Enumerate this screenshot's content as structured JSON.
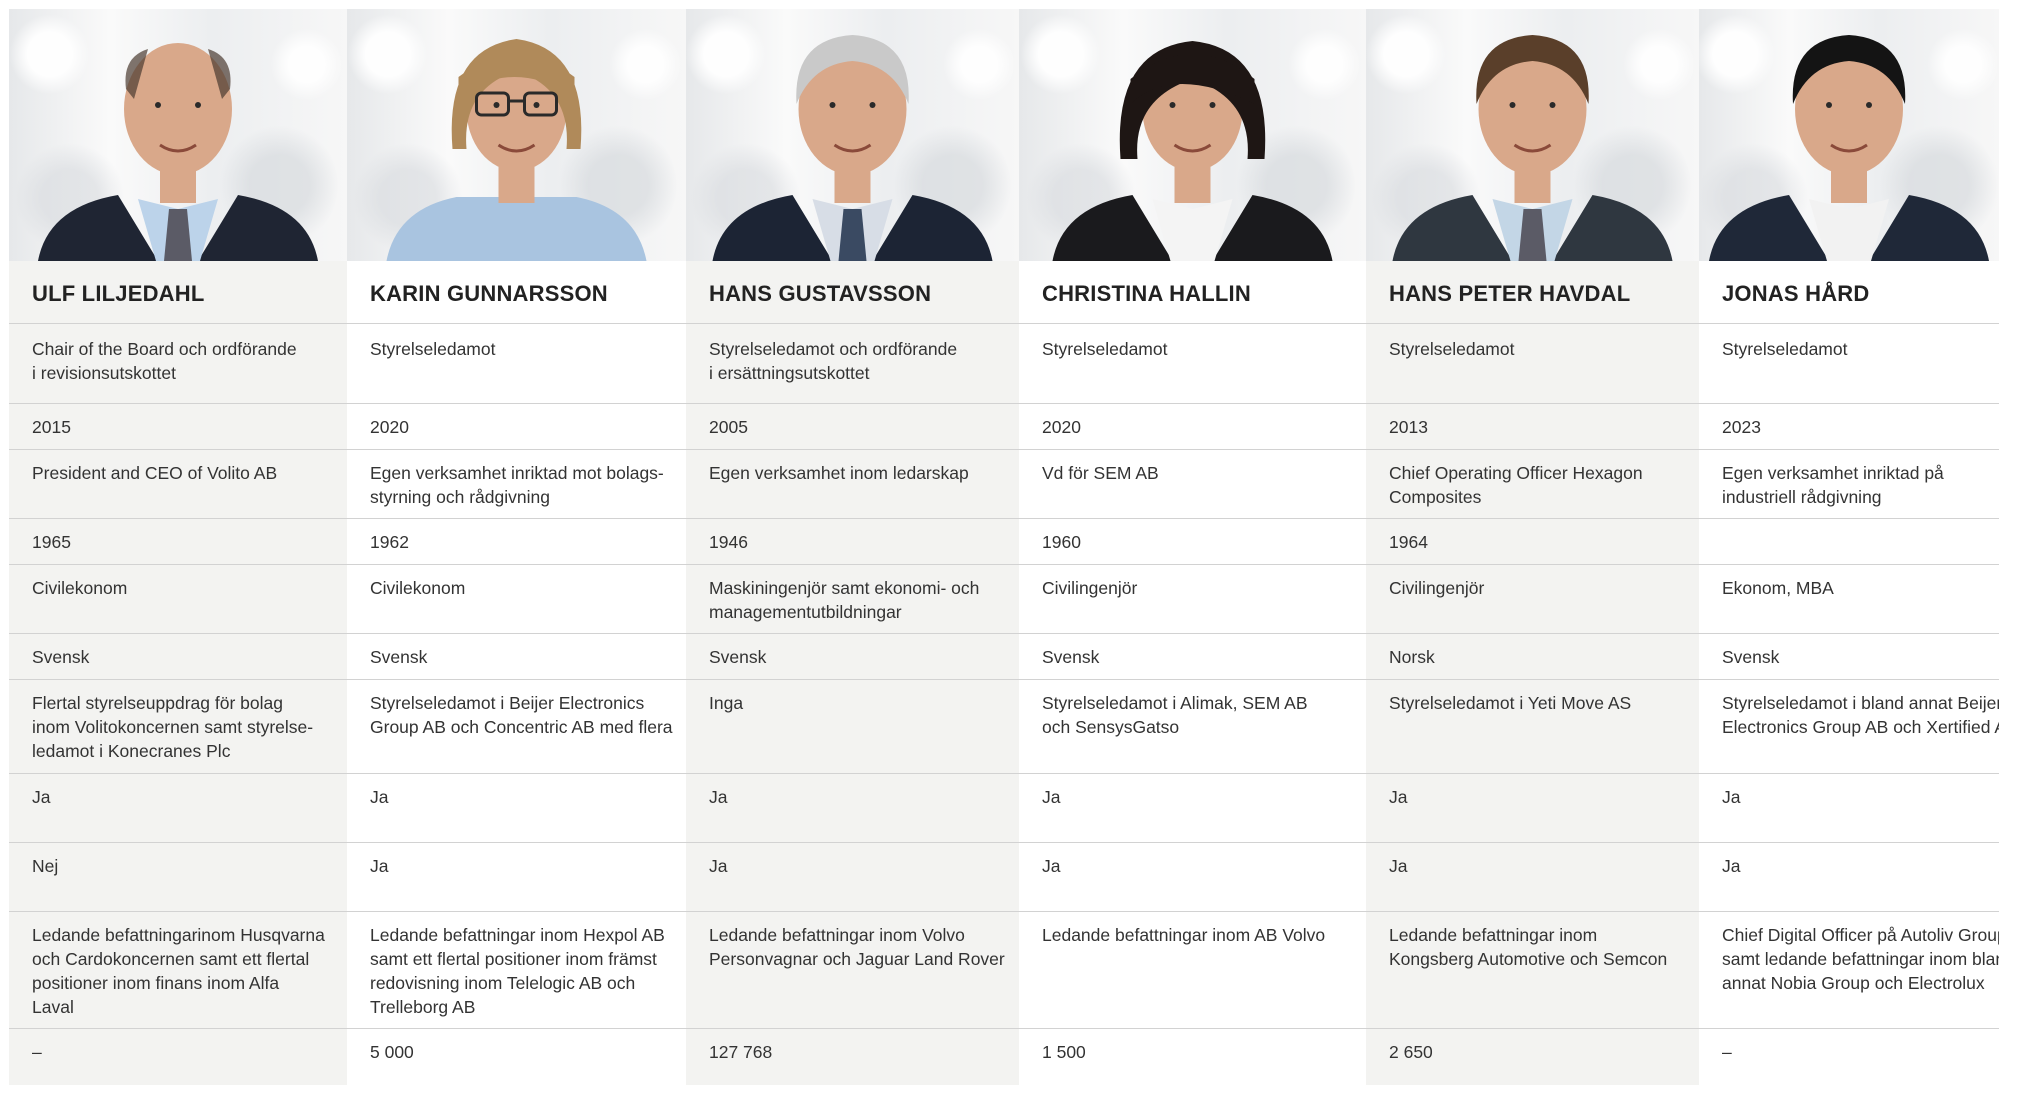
{
  "members": [
    {
      "name": "ULF LILJEDAHL",
      "portrait": "portrait-man-bald-dark-suit-light-blue-shirt",
      "role": [
        "Chair of the Board och ordförande",
        "i revisionsutskottet"
      ],
      "elected": "2015",
      "occupation": [
        "President and CEO of Volito AB"
      ],
      "born": "1965",
      "education": [
        "Civilekonom"
      ],
      "nationality": "Svensk",
      "other_assignments": [
        "Flertal styrelseuppdrag för bolag",
        "inom Volitokoncernen samt styrelse-",
        "ledamot i Konecranes Plc"
      ],
      "independent_1": "Ja",
      "independent_2": "Nej",
      "experience": [
        "Ledande befattningarinom Husqvarna",
        "och Cardokoncernen samt ett flertal",
        "positioner inom finans inom Alfa",
        "Laval"
      ],
      "holding": "–"
    },
    {
      "name": "KARIN GUNNARSSON",
      "portrait": "portrait-woman-glasses-blond-bob-light-blue-shirt",
      "role": [
        "Styrelseledamot"
      ],
      "elected": "2020",
      "occupation": [
        "Egen verksamhet  inriktad mot bolags-",
        "styrning och rådgivning"
      ],
      "born": "1962",
      "education": [
        "Civilekonom"
      ],
      "nationality": "Svensk",
      "other_assignments": [
        "Styrelseledamot i Beijer Electronics",
        "Group AB och Concentric AB med flera"
      ],
      "independent_1": "Ja",
      "independent_2": "Ja",
      "experience": [
        "Ledande befattningar inom Hexpol AB",
        "samt ett flertal positioner inom främst",
        "redovisning inom Telelogic AB och",
        "Trelleborg AB"
      ],
      "holding": "5 000"
    },
    {
      "name": "HANS GUSTAVSSON",
      "portrait": "portrait-older-man-grey-hair-striped-tie",
      "role": [
        "Styrelseledamot och ordförande",
        "i ersättningsutskottet"
      ],
      "elected": "2005",
      "occupation": [
        "Egen verksamhet inom ledarskap"
      ],
      "born": "1946",
      "education": [
        "Maskiningenjör samt ekonomi- och",
        "managementutbildningar"
      ],
      "nationality": "Svensk",
      "other_assignments": [
        "Inga"
      ],
      "independent_1": "Ja",
      "independent_2": "Ja",
      "experience": [
        "Ledande befattningar inom Volvo",
        "Personvagnar och Jaguar Land Rover"
      ],
      "holding": "127 768"
    },
    {
      "name": "CHRISTINA HALLIN",
      "portrait": "portrait-woman-dark-hair-bangs-dark-blazer",
      "role": [
        "Styrelseledamot"
      ],
      "elected": "2020",
      "occupation": [
        "Vd för SEM AB"
      ],
      "born": "1960",
      "education": [
        "Civilingenjör"
      ],
      "nationality": "Svensk",
      "other_assignments": [
        "Styrelseledamot i Alimak, SEM AB",
        "och SensysGatso"
      ],
      "independent_1": "Ja",
      "independent_2": "Ja",
      "experience": [
        "Ledande befattningar inom AB Volvo"
      ],
      "holding": "1 500"
    },
    {
      "name": "HANS PETER HAVDAL",
      "portrait": "portrait-man-brown-hair-grey-suit-patterned-tie",
      "role": [
        "Styrelseledamot"
      ],
      "elected": "2013",
      "occupation": [
        "Chief Operating Officer Hexagon",
        "Composites"
      ],
      "born": "1964",
      "education": [
        "Civilingenjör"
      ],
      "nationality": "Norsk",
      "other_assignments": [
        "Styrelseledamot i Yeti Move AS"
      ],
      "independent_1": "Ja",
      "independent_2": "Ja",
      "experience": [
        "Ledande befattningar inom",
        "Kongsberg Automotive och Semcon"
      ],
      "holding": "2 650"
    },
    {
      "name": "JONAS HÅRD",
      "portrait": "portrait-man-black-hair-dark-jacket-white-shirt",
      "role": [
        "Styrelseledamot"
      ],
      "elected": "2023",
      "occupation": [
        "Egen verksamhet inriktad på",
        "industriell rådgivning"
      ],
      "born": "",
      "education": [
        "Ekonom, MBA"
      ],
      "nationality": "Svensk",
      "other_assignments": [
        "Styrelseledamot i bland annat Beijer",
        "Electronics Group AB och Xertified AB"
      ],
      "independent_1": "Ja",
      "independent_2": "Ja",
      "experience": [
        "Chief Digital Officer på Autoliv Group",
        "samt ledande befattningar inom bland",
        "annat Nobia Group och Electrolux"
      ],
      "holding": "–"
    }
  ],
  "colors": {
    "shaded_column": "#f3f3f1",
    "plain_column": "#ffffff",
    "divider": "#d2d2d2",
    "text": "#333333",
    "name_text": "#222222",
    "suit_dark": "#1f2533",
    "skin": "#d9a88a"
  }
}
